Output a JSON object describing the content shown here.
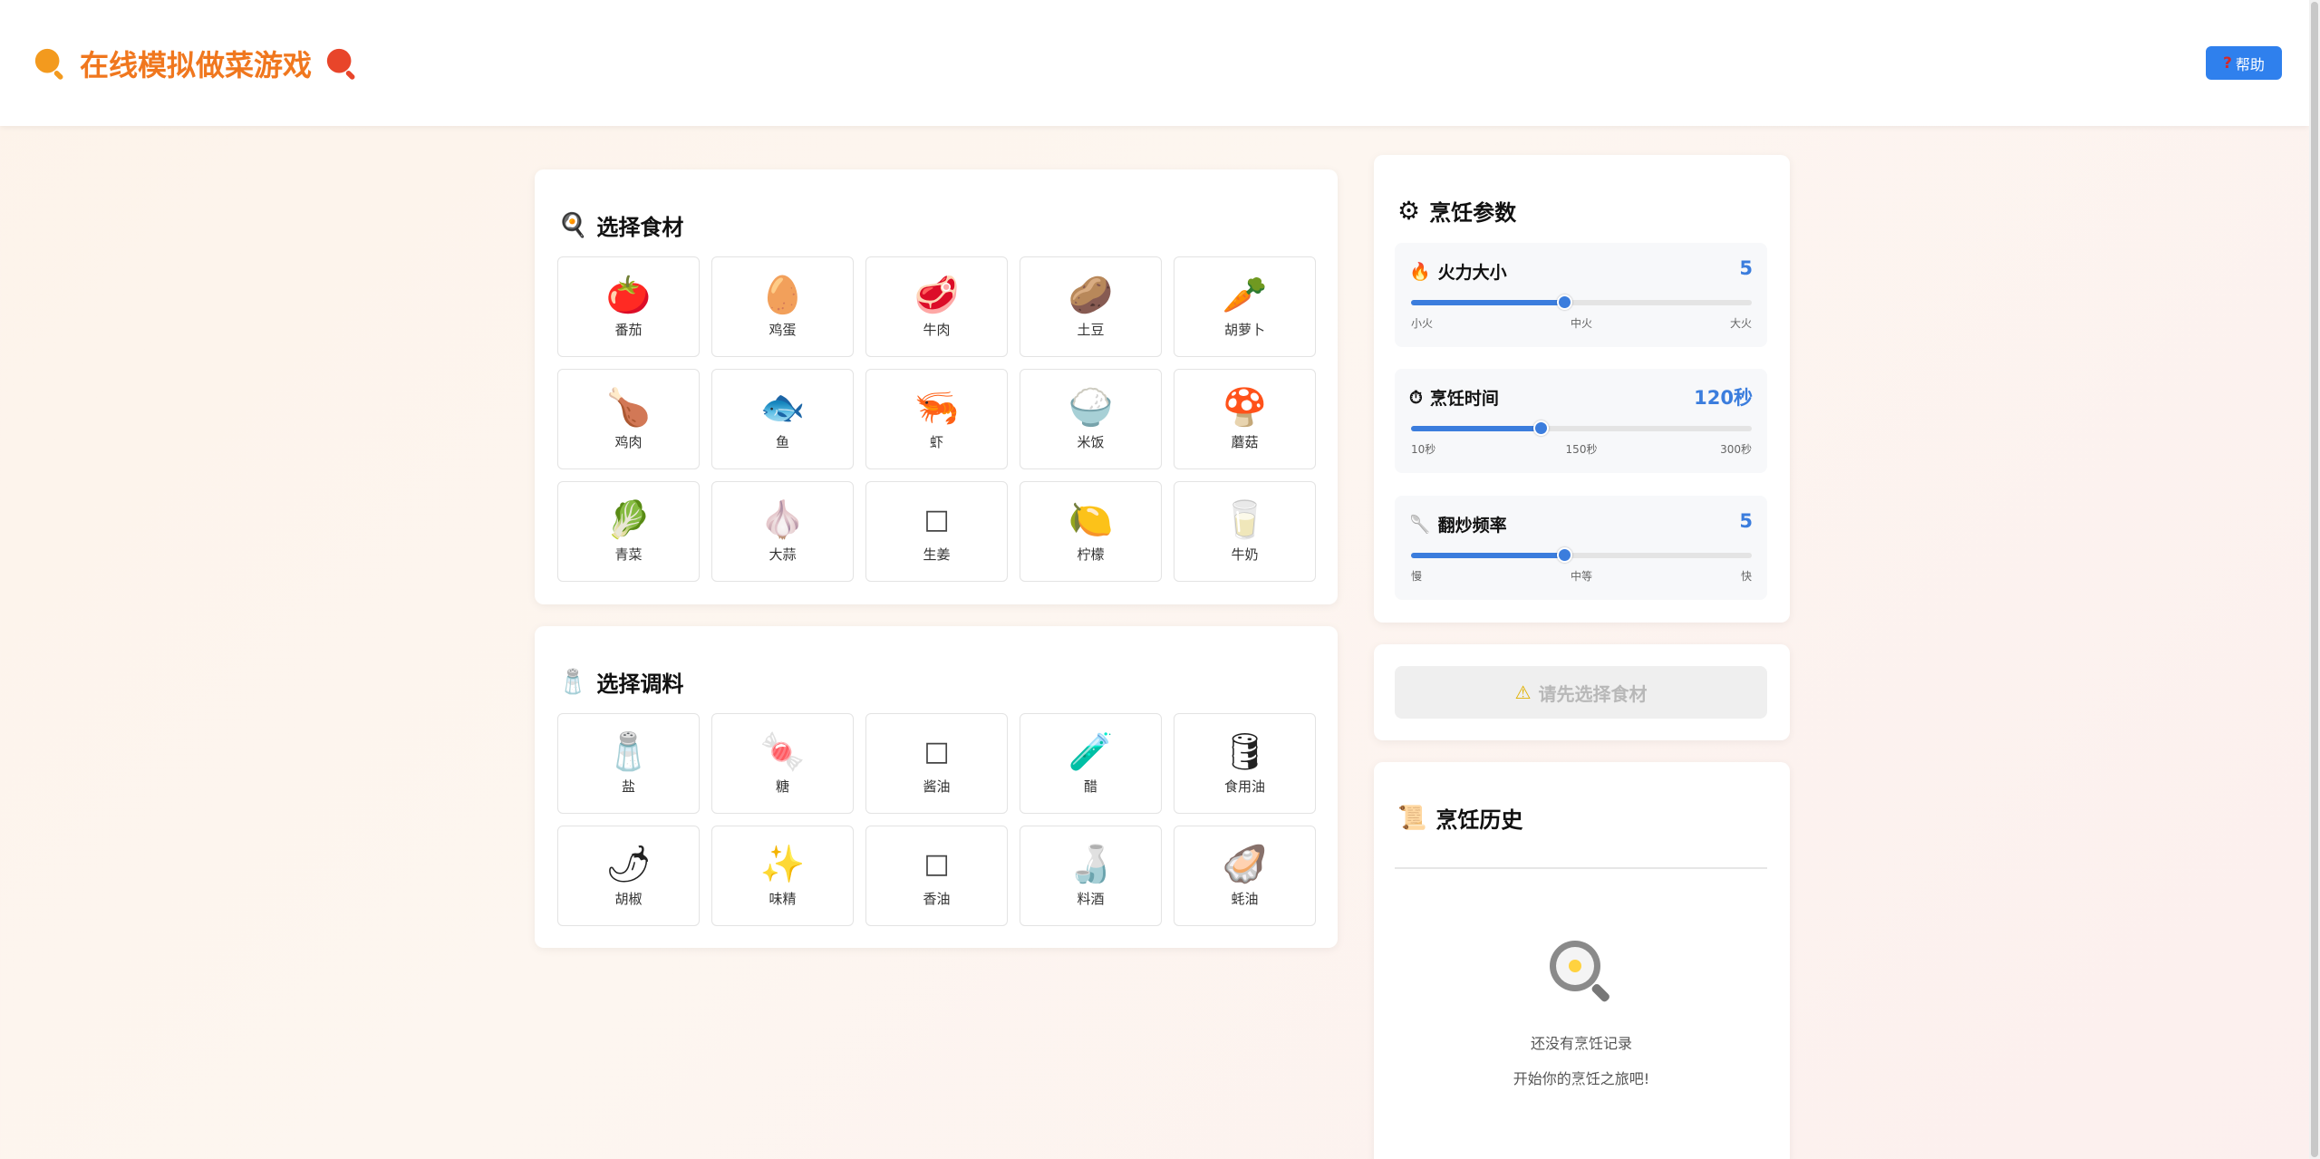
{
  "app": {
    "title": "在线模拟做菜游戏",
    "help_label": "帮助",
    "help_icon": "?"
  },
  "ingredients": {
    "title": "选择食材",
    "title_icon": "🍳",
    "items": [
      {
        "emoji": "🍅",
        "label": "番茄",
        "name": "tomato"
      },
      {
        "emoji": "🥚",
        "label": "鸡蛋",
        "name": "egg"
      },
      {
        "emoji": "🥩",
        "label": "牛肉",
        "name": "beef"
      },
      {
        "emoji": "🥔",
        "label": "土豆",
        "name": "potato"
      },
      {
        "emoji": "🥕",
        "label": "胡萝卜",
        "name": "carrot"
      },
      {
        "emoji": "🍗",
        "label": "鸡肉",
        "name": "chicken"
      },
      {
        "emoji": "🐟",
        "label": "鱼",
        "name": "fish"
      },
      {
        "emoji": "🦐",
        "label": "虾",
        "name": "shrimp"
      },
      {
        "emoji": "🍚",
        "label": "米饭",
        "name": "rice"
      },
      {
        "emoji": "🍄",
        "label": "蘑菇",
        "name": "mushroom"
      },
      {
        "emoji": "🥬",
        "label": "青菜",
        "name": "greens"
      },
      {
        "emoji": "🧄",
        "label": "大蒜",
        "name": "garlic"
      },
      {
        "emoji": "□",
        "label": "生姜",
        "name": "ginger"
      },
      {
        "emoji": "🍋",
        "label": "柠檬",
        "name": "lemon"
      },
      {
        "emoji": "🥛",
        "label": "牛奶",
        "name": "milk"
      }
    ]
  },
  "seasonings": {
    "title": "选择调料",
    "title_icon": "🧂",
    "items": [
      {
        "emoji": "🧂",
        "label": "盐",
        "name": "salt"
      },
      {
        "emoji": "🍬",
        "label": "糖",
        "name": "sugar"
      },
      {
        "emoji": "□",
        "label": "酱油",
        "name": "soy-sauce"
      },
      {
        "emoji": "🧪",
        "label": "醋",
        "name": "vinegar"
      },
      {
        "emoji": "🛢",
        "label": "食用油",
        "name": "cooking-oil"
      },
      {
        "emoji": "🌶",
        "label": "胡椒",
        "name": "pepper"
      },
      {
        "emoji": "✨",
        "label": "味精",
        "name": "msg"
      },
      {
        "emoji": "□",
        "label": "香油",
        "name": "sesame-oil"
      },
      {
        "emoji": "🍶",
        "label": "料酒",
        "name": "cooking-wine"
      },
      {
        "emoji": "🦪",
        "label": "蚝油",
        "name": "oyster-sauce"
      }
    ]
  },
  "params": {
    "title": "烹饪参数",
    "title_icon": "⚙",
    "heat": {
      "label": "火力大小",
      "icon": "🔥",
      "value": "5",
      "level": 0.45,
      "ticks": [
        "小火",
        "中火",
        "大火"
      ]
    },
    "time": {
      "label": "烹饪时间",
      "icon": "⏱",
      "value": "120秒",
      "level": 0.38,
      "ticks": [
        "10秒",
        "150秒",
        "300秒"
      ]
    },
    "stir": {
      "label": "翻炒频率",
      "icon": "🥄",
      "value": "5",
      "level": 0.45,
      "ticks": [
        "慢",
        "中等",
        "快"
      ]
    }
  },
  "cook_button": {
    "label": "请先选择食材",
    "icon": "⚠"
  },
  "history": {
    "title": "烹饪历史",
    "title_icon": "📜",
    "empty_icon": "🍳",
    "empty_line1": "还没有烹饪记录",
    "empty_line2": "开始你的烹饪之旅吧!"
  },
  "colors": {
    "brand": "#f0771e",
    "accent": "#3b7ddd",
    "help_button": "#2f80ed"
  }
}
